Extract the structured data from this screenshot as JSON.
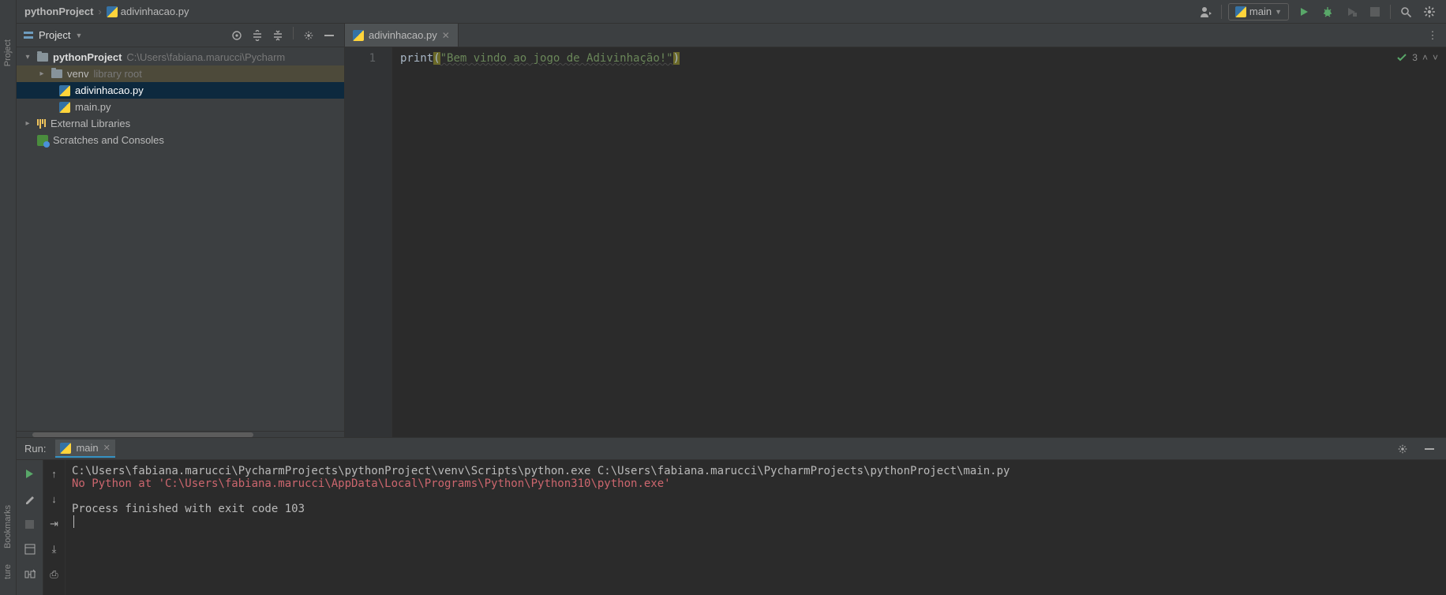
{
  "breadcrumbs": {
    "project": "pythonProject",
    "file": "adivinhacao.py"
  },
  "run_config": {
    "name": "main"
  },
  "project_panel": {
    "title": "Project",
    "root": {
      "name": "pythonProject",
      "path": "C:\\Users\\fabiana.marucci\\Pycharm"
    },
    "venv": {
      "name": "venv",
      "hint": "library root"
    },
    "files": {
      "f0": "adivinhacao.py",
      "f1": "main.py"
    },
    "ext_lib": "External Libraries",
    "scratches": "Scratches and Consoles"
  },
  "editor": {
    "tab": "adivinhacao.py",
    "line_no": "1",
    "code": {
      "fn": "print",
      "lparen": "(",
      "str": "\"Bem vindo ao jogo de Adivinhação!\"",
      "rparen": ")"
    },
    "inspections_count": "3"
  },
  "run_panel": {
    "label": "Run:",
    "tab": "main",
    "console": {
      "line1": "C:\\Users\\fabiana.marucci\\PycharmProjects\\pythonProject\\venv\\Scripts\\python.exe C:\\Users\\fabiana.marucci\\PycharmProjects\\pythonProject\\main.py",
      "line2": "No Python at 'C:\\Users\\fabiana.marucci\\AppData\\Local\\Programs\\Python\\Python310\\python.exe'",
      "line3": "Process finished with exit code 103"
    }
  },
  "left_gutter": {
    "project": "Project",
    "bookmarks": "Bookmarks",
    "structure": "ture"
  }
}
